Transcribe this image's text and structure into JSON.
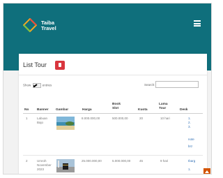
{
  "brand": {
    "line1": "Taiba",
    "line2": "Travel"
  },
  "card": {
    "title": "List Tour"
  },
  "controls": {
    "show_label": "Show",
    "show_value": "10",
    "entries_label": "entries",
    "search_label": "Search:"
  },
  "table": {
    "headers": {
      "no": "No",
      "banner": "Banner",
      "gambar": "Gambar",
      "harga": "Harga",
      "book_slot": [
        "Book",
        "Slot"
      ],
      "kuota": "Kuota",
      "lama_tour": [
        "Lama",
        "Tour"
      ],
      "desk": "Desk"
    },
    "rows": [
      {
        "no": "1",
        "banner": [
          "Labuan",
          "Bajo"
        ],
        "harga": "8.000.000,00",
        "book_slot": "500.000,00",
        "kuota": "20",
        "lama_tour": "10 hari",
        "desk": [
          "1.",
          "2.",
          "3.",
          "note",
          "brz"
        ]
      },
      {
        "no": "2",
        "banner": [
          "Umroh",
          "November",
          "2023"
        ],
        "harga": "25.000.000,00",
        "book_slot": "5.000.000,00",
        "kuota": "45",
        "lama_tour": "9 hari",
        "desk": [
          "Ibarg",
          "1."
        ]
      }
    ]
  },
  "colors": {
    "header_bg": "#0f6f7c",
    "delete_btn": "#d9363e",
    "scroll_btn": "#d35400"
  }
}
